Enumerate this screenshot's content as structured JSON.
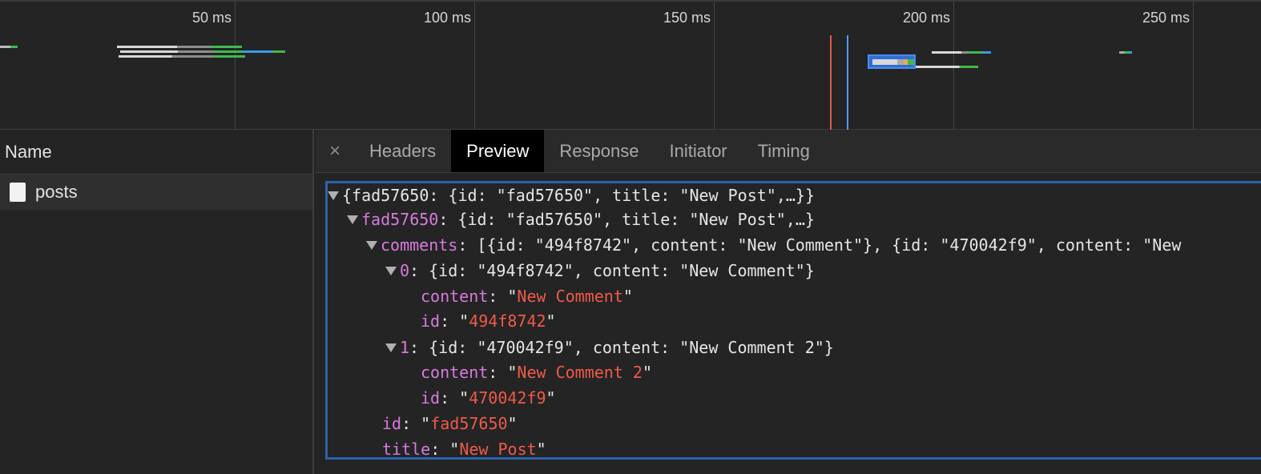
{
  "timeline": {
    "ticks": [
      "50 ms",
      "100 ms",
      "150 ms",
      "200 ms",
      "250 ms"
    ]
  },
  "name_panel": {
    "header": "Name",
    "rows": [
      {
        "label": "posts"
      }
    ]
  },
  "tabs": {
    "close": "×",
    "items": [
      "Headers",
      "Preview",
      "Response",
      "Initiator",
      "Timing"
    ],
    "active": "Preview"
  },
  "preview": {
    "l0_summary": "{fad57650: {id: \"fad57650\", title: \"New Post\",…}}",
    "l1_key": "fad57650",
    "l1_rest": ": {id: \"fad57650\", title: \"New Post\",…}",
    "l2_key": "comments",
    "l2_rest": ": [{id: \"494f8742\", content: \"New Comment\"}, {id: \"470042f9\", content: \"New",
    "l3_key": "0",
    "l3_rest": ": {id: \"494f8742\", content: \"New Comment\"}",
    "l4_key": "content",
    "l4_val": "New Comment",
    "l5_key": "id",
    "l5_val": "494f8742",
    "l6_key": "1",
    "l6_rest": ": {id: \"470042f9\", content: \"New Comment 2\"}",
    "l7_key": "content",
    "l7_val": "New Comment 2",
    "l8_key": "id",
    "l8_val": "470042f9",
    "l9_key": "id",
    "l9_val": "fad57650",
    "l10_key": "title",
    "l10_val": "New Post"
  },
  "colors": {
    "key": "#d77bdd",
    "string": "#f05a4a",
    "selection_border": "#2a64ad",
    "marker_red": "#e0584a",
    "marker_blue": "#4a9df0"
  }
}
